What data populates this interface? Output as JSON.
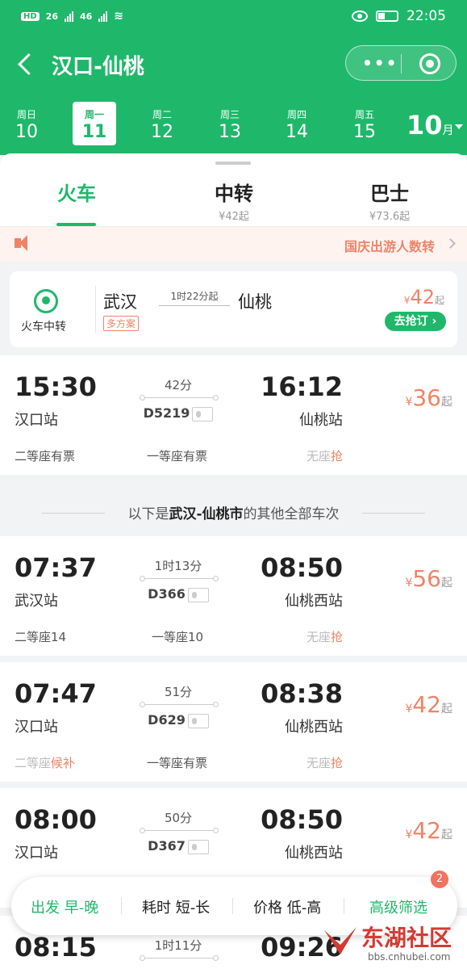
{
  "status": {
    "network": "HD",
    "sim1": "26",
    "sim2": "46",
    "time": "22:05"
  },
  "header": {
    "title": "汉口-仙桃"
  },
  "dates": [
    {
      "week": "周日",
      "day": "10"
    },
    {
      "week": "周一",
      "day": "11",
      "active": true
    },
    {
      "week": "周二",
      "day": "12"
    },
    {
      "week": "周三",
      "day": "13"
    },
    {
      "week": "周四",
      "day": "14"
    },
    {
      "week": "周五",
      "day": "15"
    }
  ],
  "month": {
    "num": "10",
    "unit": "月"
  },
  "tabs": [
    {
      "label": "火车",
      "sub": ""
    },
    {
      "label": "中转",
      "sub": "¥42起"
    },
    {
      "label": "巴士",
      "sub": "¥73.6起"
    }
  ],
  "notice": {
    "text": "国庆出游人数转"
  },
  "transfer": {
    "label": "火车中转",
    "from": "武汉",
    "to": "仙桃",
    "duration": "1时22分起",
    "tag": "多方案",
    "currency": "¥",
    "price": "42",
    "price_suffix": "起",
    "button": "去抢订"
  },
  "separator": {
    "prefix": "以下是",
    "route": "武汉-仙桃市",
    "suffix": "的其他全部车次"
  },
  "trains": [
    {
      "dep": "15:30",
      "dep_station": "汉口站",
      "duration": "42分",
      "train_no": "D5219",
      "arr": "16:12",
      "arr_station": "仙桃站",
      "currency": "¥",
      "price": "36",
      "price_suffix": "起",
      "seat1": "二等座有票",
      "seat2": "一等座有票",
      "seat3": "无座",
      "seat3_action": "抢"
    },
    {
      "dep": "07:37",
      "dep_station": "武汉站",
      "duration": "1时13分",
      "train_no": "D366",
      "arr": "08:50",
      "arr_station": "仙桃西站",
      "currency": "¥",
      "price": "56",
      "price_suffix": "起",
      "seat1": "二等座14",
      "seat2": "一等座10",
      "seat3": "无座",
      "seat3_action": "抢"
    },
    {
      "dep": "07:47",
      "dep_station": "汉口站",
      "duration": "51分",
      "train_no": "D629",
      "arr": "08:38",
      "arr_station": "仙桃西站",
      "currency": "¥",
      "price": "42",
      "price_suffix": "起",
      "seat1": "二等座",
      "seat1_action": "候补",
      "seat2": "一等座有票",
      "seat3": "无座",
      "seat3_action": "抢"
    },
    {
      "dep": "08:00",
      "dep_station": "汉口站",
      "duration": "50分",
      "train_no": "D367",
      "arr": "08:50",
      "arr_station": "仙桃西站",
      "currency": "¥",
      "price": "42",
      "price_suffix": "起"
    },
    {
      "dep": "08:15",
      "duration": "1时11分",
      "arr": "09:26"
    }
  ],
  "filters": {
    "depart": "出发 早-晚",
    "duration": "耗时 短-长",
    "price": "价格 低-高",
    "advanced": "高级筛选",
    "badge": "2"
  },
  "watermark": {
    "title": "东湖社区",
    "url": "bbs.cnhubei.com"
  },
  "colors": {
    "primary": "#1fb86b",
    "accent": "#f08367"
  }
}
